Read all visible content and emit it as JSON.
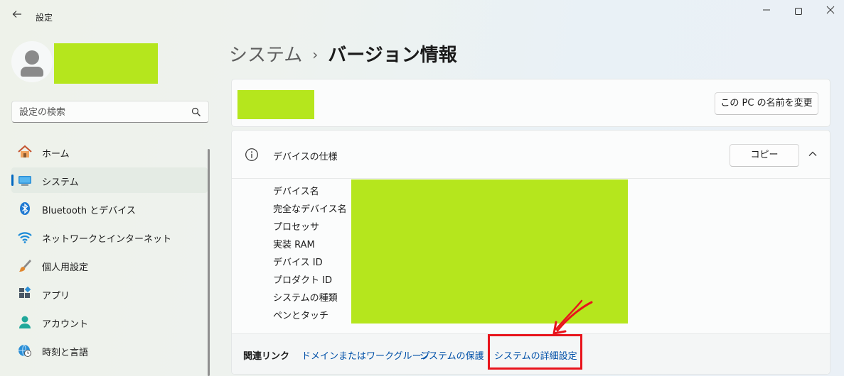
{
  "window": {
    "title": "設定",
    "back_icon": "arrow-left-icon",
    "controls": [
      "minimize",
      "maximize",
      "close"
    ]
  },
  "sidebar": {
    "search": {
      "placeholder": "設定の検索",
      "value": ""
    },
    "items": [
      {
        "label": "ホーム",
        "icon": "home-icon",
        "active": false
      },
      {
        "label": "システム",
        "icon": "monitor-icon",
        "active": true
      },
      {
        "label": "Bluetooth とデバイス",
        "icon": "bluetooth-icon",
        "active": false
      },
      {
        "label": "ネットワークとインターネット",
        "icon": "wifi-icon",
        "active": false
      },
      {
        "label": "個人用設定",
        "icon": "brush-icon",
        "active": false
      },
      {
        "label": "アプリ",
        "icon": "apps-icon",
        "active": false
      },
      {
        "label": "アカウント",
        "icon": "person-icon",
        "active": false
      },
      {
        "label": "時刻と言語",
        "icon": "globe-clock-icon",
        "active": false
      }
    ]
  },
  "breadcrumb": {
    "parent": "システム",
    "separator": "›",
    "current": "バージョン情報"
  },
  "pc_card": {
    "rename_button": "この PC の名前を変更"
  },
  "spec": {
    "title": "デバイスの仕様",
    "copy_button": "コピー",
    "labels": [
      "デバイス名",
      "完全なデバイス名",
      "プロセッサ",
      "実装 RAM",
      "デバイス ID",
      "プロダクト ID",
      "システムの種類",
      "ペンとタッチ"
    ]
  },
  "related": {
    "label": "関連リンク",
    "links": [
      "ドメインまたはワークグループ",
      "システムの保護",
      "システムの詳細設定"
    ]
  },
  "colors": {
    "accent": "#0067c0",
    "redaction": "#b5e61d",
    "annotation": "#e8141c",
    "link": "#0050a8"
  }
}
